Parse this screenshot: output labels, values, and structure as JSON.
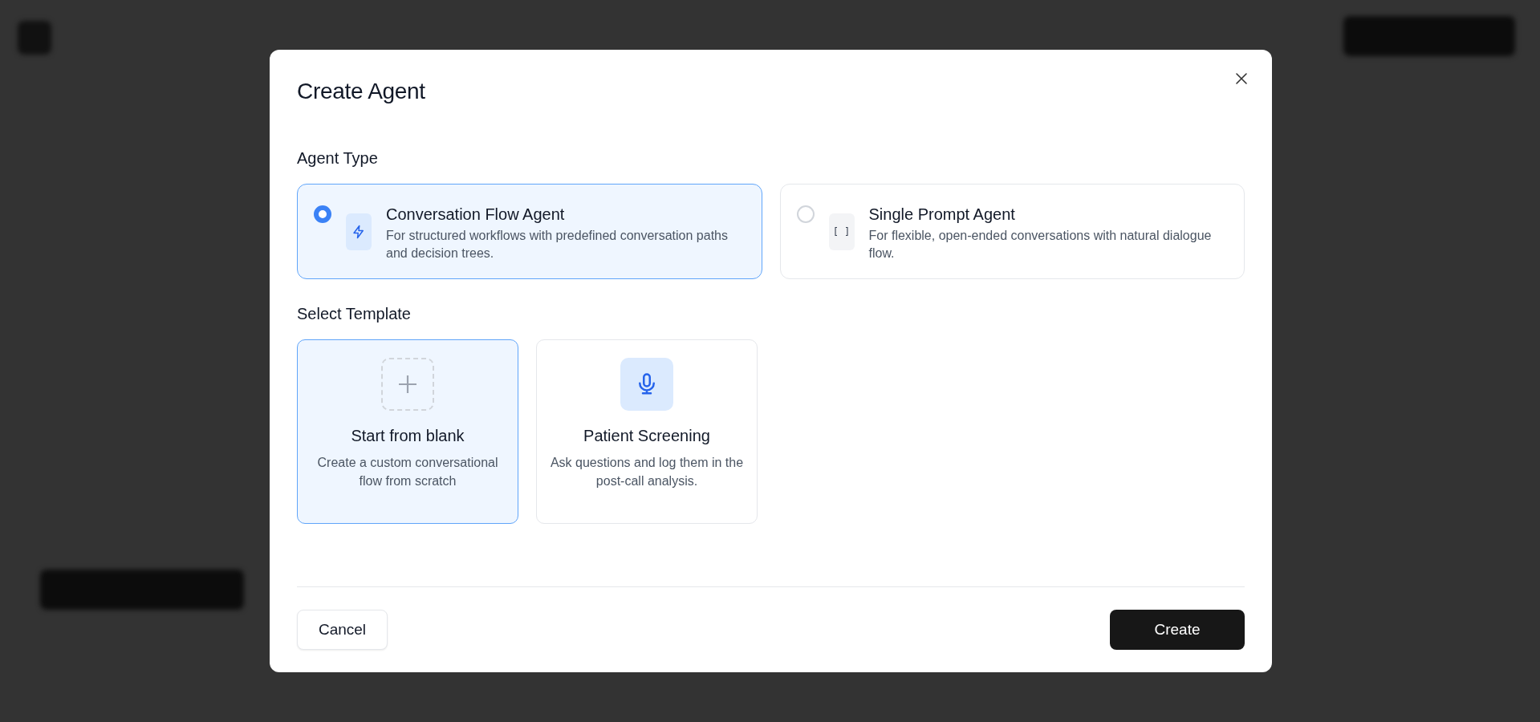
{
  "dialog": {
    "title": "Create Agent",
    "agent_type": {
      "label": "Agent Type",
      "options": [
        {
          "kind": "bolt",
          "title": "Conversation Flow Agent",
          "description": "For structured workflows with predefined conversation paths and decision trees.",
          "selected": true
        },
        {
          "kind": "brackets",
          "icon_text": "[ ]",
          "title": "Single Prompt Agent",
          "description": "For flexible, open-ended conversations with natural dialogue flow.",
          "selected": false
        }
      ]
    },
    "templates": {
      "label": "Select Template",
      "items": [
        {
          "kind": "blank",
          "title": "Start from blank",
          "description": "Create a custom conversational flow from scratch",
          "selected": true
        },
        {
          "kind": "mic",
          "title": "Patient Screening",
          "description": "Ask questions and log them in the post-call analysis.",
          "selected": false
        }
      ]
    },
    "buttons": {
      "cancel": "Cancel",
      "create": "Create"
    }
  }
}
